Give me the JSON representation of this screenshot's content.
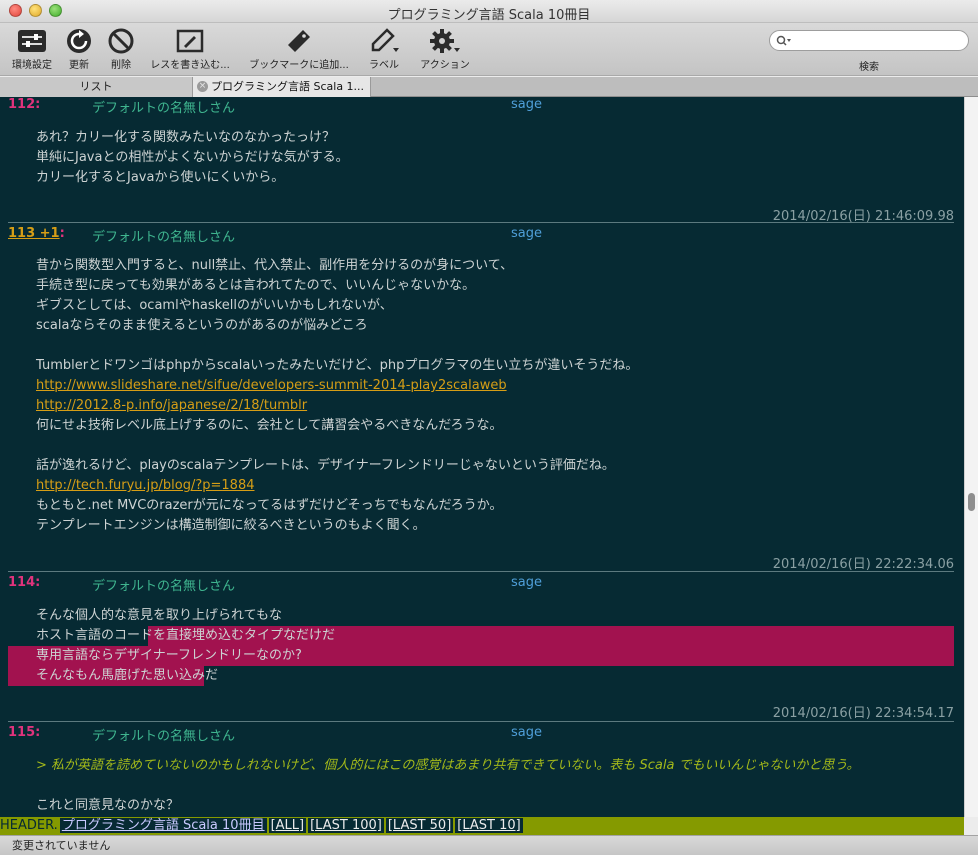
{
  "window": {
    "title": "プログラミング言語 Scala 10冊目"
  },
  "toolbar": {
    "buttons": [
      {
        "label": "環境設定",
        "icon": "preferences-icon"
      },
      {
        "label": "更新",
        "icon": "refresh-icon"
      },
      {
        "label": "削除",
        "icon": "delete-icon"
      },
      {
        "label": "レスを書き込む...",
        "icon": "compose-icon"
      },
      {
        "label": "ブックマークに追加...",
        "icon": "bookmark-icon"
      },
      {
        "label": "ラベル",
        "icon": "label-icon"
      },
      {
        "label": "アクション",
        "icon": "action-gear-icon"
      }
    ],
    "search_label": "検索",
    "search_value": ""
  },
  "tabs": {
    "list_label": "リスト",
    "active_label": "プログラミング言語 Scala 1..."
  },
  "posts": [
    {
      "number": "112:",
      "name": "デフォルトの名無しさん",
      "mail": "sage",
      "lines": [
        "あれ？カリー化する関数みたいなのなかったっけ？",
        "単純にJavaとの相性がよくないからだけな気がする。",
        "カリー化するとJavaから使いにくいから。"
      ],
      "date": "2014/02/16(日) 21:46:09.98"
    },
    {
      "number": "113 +1",
      "name": "デフォルトの名無しさん",
      "mail": "sage",
      "lines": [
        "昔から関数型入門すると、null禁止、代入禁止、副作用を分けるのが身について、",
        "手続き型に戻っても効果があるとは言われてたので、いいんじゃないかな。",
        "ギブスとしては、ocamlやhaskellのがいいかもしれないが、",
        "scalaならそのまま使えるというのがあるのが悩みどころ",
        "",
        "Tumblerとドワンゴはphpからscalaいったみたいだけど、phpプログラマの生い立ちが違いそうだね。",
        "http://www.slideshare.net/sifue/developers-summit-2014-play2scalaweb",
        "http://2012.8-p.info/japanese/2/18/tumblr",
        "何にせよ技術レベル底上げするのに、会社として講習会やるべきなんだろうな。",
        "",
        "話が逸れるけど、playのscalaテンプレートは、デザイナーフレンドリーじゃないという評価だね。",
        "http://tech.furyu.jp/blog/?p=1884",
        "もともと.net MVCのrazerが元になってるはずだけどそっちでもなんだろうか。",
        "テンプレートエンジンは構造制御に絞るべきというのもよく聞く。"
      ],
      "date": "2014/02/16(日) 22:22:34.06"
    },
    {
      "number": "114:",
      "name": "デフォルトの名無しさん",
      "mail": "sage",
      "lines": [
        "そんな個人的な意見を取り上げられてもな",
        "ホスト言語のコードを直接埋め込むタイプなだけだ",
        "専用言語ならデザイナーフレンドリーなのか?",
        "そんなもん馬鹿げた思い込みだ"
      ],
      "date": "2014/02/16(日) 22:34:54.17"
    },
    {
      "number": "115:",
      "name": "デフォルトの名無しさん",
      "mail": "sage",
      "quote": "> 私が英語を読めていないのかもしれないけど、個人的にはこの感覚はあまり共有できていない。表も Scala でもいいんじゃないかと思う。",
      "lines": [
        "これと同意見なのかな？"
      ]
    }
  ],
  "header_bar": {
    "prefix": "HEADER.",
    "title_link": "プログラミング言語 Scala 10冊目",
    "links": [
      "[ALL]",
      "[LAST 100]",
      "[LAST 50]",
      "[LAST 10]"
    ]
  },
  "status": {
    "text": "変更されていません"
  },
  "colors": {
    "background": "#062a33",
    "post_number": "#e0337c",
    "name": "#3fb58f",
    "mail": "#4f9fd9",
    "link": "#d69e16",
    "highlight": "#a2124f",
    "quote": "#a3b91a",
    "header_bar": "#859a00"
  }
}
